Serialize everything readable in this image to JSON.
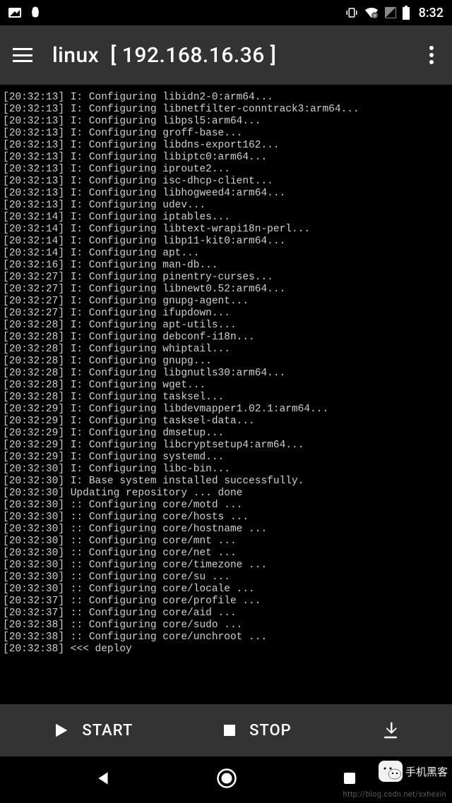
{
  "status": {
    "clock": "8:32"
  },
  "header": {
    "title_prefix": "linux",
    "title_ip": "[ 192.168.16.36 ]"
  },
  "terminal": {
    "lines": [
      "[20:32:13] I: Configuring libidn2-0:arm64...",
      "[20:32:13] I: Configuring libnetfilter-conntrack3:arm64...",
      "[20:32:13] I: Configuring libpsl5:arm64...",
      "[20:32:13] I: Configuring groff-base...",
      "[20:32:13] I: Configuring libdns-export162...",
      "[20:32:13] I: Configuring libiptc0:arm64...",
      "[20:32:13] I: Configuring iproute2...",
      "[20:32:13] I: Configuring isc-dhcp-client...",
      "[20:32:13] I: Configuring libhogweed4:arm64...",
      "[20:32:13] I: Configuring udev...",
      "[20:32:14] I: Configuring iptables...",
      "[20:32:14] I: Configuring libtext-wrapi18n-perl...",
      "[20:32:14] I: Configuring libp11-kit0:arm64...",
      "[20:32:14] I: Configuring apt...",
      "[20:32:16] I: Configuring man-db...",
      "[20:32:27] I: Configuring pinentry-curses...",
      "[20:32:27] I: Configuring libnewt0.52:arm64...",
      "[20:32:27] I: Configuring gnupg-agent...",
      "[20:32:27] I: Configuring ifupdown...",
      "[20:32:28] I: Configuring apt-utils...",
      "[20:32:28] I: Configuring debconf-i18n...",
      "[20:32:28] I: Configuring whiptail...",
      "[20:32:28] I: Configuring gnupg...",
      "[20:32:28] I: Configuring libgnutls30:arm64...",
      "[20:32:28] I: Configuring wget...",
      "[20:32:28] I: Configuring tasksel...",
      "[20:32:29] I: Configuring libdevmapper1.02.1:arm64...",
      "[20:32:29] I: Configuring tasksel-data...",
      "[20:32:29] I: Configuring dmsetup...",
      "[20:32:29] I: Configuring libcryptsetup4:arm64...",
      "[20:32:29] I: Configuring systemd...",
      "[20:32:30] I: Configuring libc-bin...",
      "[20:32:30] I: Base system installed successfully.",
      "[20:32:30] Updating repository ... done",
      "[20:32:30] :: Configuring core/motd ...",
      "[20:32:30] :: Configuring core/hosts ...",
      "[20:32:30] :: Configuring core/hostname ...",
      "[20:32:30] :: Configuring core/mnt ...",
      "[20:32:30] :: Configuring core/net ...",
      "[20:32:30] :: Configuring core/timezone ...",
      "[20:32:30] :: Configuring core/su ...",
      "[20:32:30] :: Configuring core/locale ...",
      "[20:32:37] :: Configuring core/profile ...",
      "[20:32:37] :: Configuring core/aid ...",
      "[20:32:38] :: Configuring core/sudo ...",
      "[20:32:38] :: Configuring core/unchroot ...",
      "[20:32:38] <<< deploy"
    ]
  },
  "bottom": {
    "start_label": "START",
    "stop_label": "STOP"
  },
  "overlay": {
    "stamp_text": "手机黑客",
    "watermark": "http://blog.csdn.net/sxhexin"
  }
}
